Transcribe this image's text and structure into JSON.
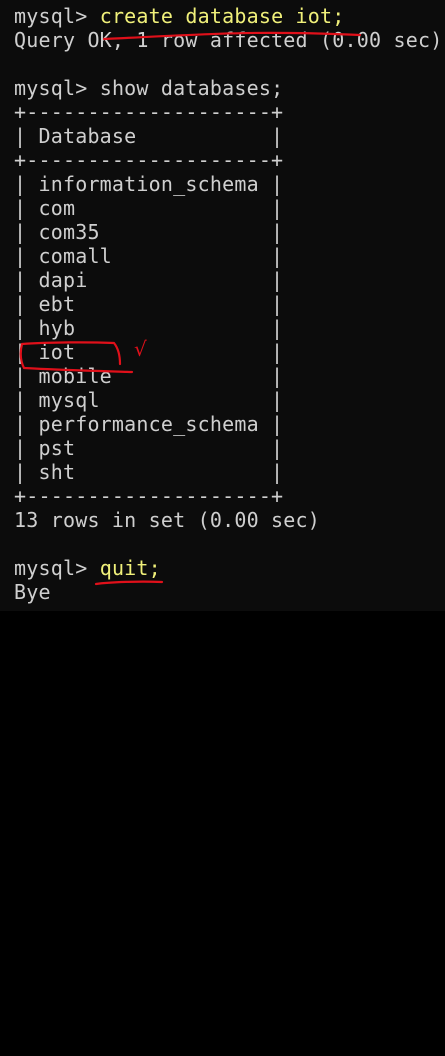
{
  "terminal": {
    "prompt": "mysql>",
    "lines": {
      "cmd1": "create database iot;",
      "result1": "Query OK, 1 row affected (0.00 sec)",
      "cmd2": "show databases;",
      "border": "+--------------------+",
      "header": "| Database           |",
      "rows": [
        "| information_schema |",
        "| com                |",
        "| com35              |",
        "| comall             |",
        "| dapi               |",
        "| ebt                |",
        "| hyb                |",
        "| iot                |",
        "| mobile             |",
        "| mysql              |",
        "| performance_schema |",
        "| pst                |",
        "| sht                |"
      ],
      "rows_summary": "13 rows in set (0.00 sec)",
      "cmd3": "quit;",
      "bye": "Bye"
    }
  },
  "colors": {
    "background": "#0c0c0c",
    "text": "#cfcfcf",
    "command": "#f0f07a",
    "annotation": "#e0101a"
  },
  "annotations": {
    "checkmark_glyph": "√"
  }
}
